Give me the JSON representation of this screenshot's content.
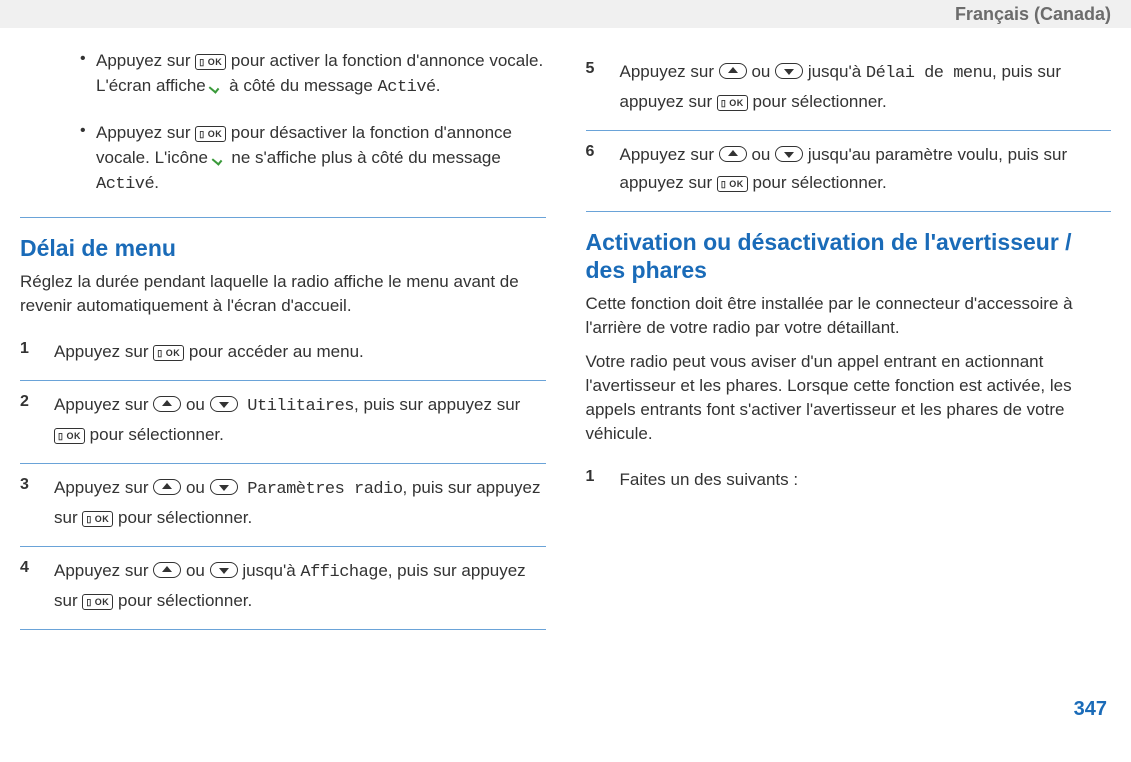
{
  "header": {
    "language": "Français (Canada)"
  },
  "pageNumber": "347",
  "bullets": [
    {
      "a": "Appuyez sur ",
      "b": " pour activer la fonction d'annonce vocale. L'écran affiche ",
      "c": " à côté du message ",
      "mono1": "Activé",
      "end": "."
    },
    {
      "a": "Appuyez sur ",
      "b": " pour désactiver la fonction d'annonce vocale. L'icône ",
      "c": " ne s'affiche plus à côté du message ",
      "mono1": "Activé",
      "end": "."
    }
  ],
  "section1": {
    "title": "Délai de menu",
    "intro": "Réglez la durée pendant laquelle la radio affiche le menu avant de revenir automatiquement à l'écran d'accueil."
  },
  "steps1": [
    {
      "num": "1",
      "a": "Appuyez sur ",
      "b": " pour accéder au menu."
    },
    {
      "num": "2",
      "a": "Appuyez sur ",
      "mid": " ou ",
      "mono": " Utilitaires",
      "b": ", puis sur appuyez sur ",
      "c": " pour sélectionner."
    },
    {
      "num": "3",
      "a": "Appuyez sur ",
      "mid": " ou ",
      "mono": " Paramètres radio",
      "b": ", puis sur appuyez sur ",
      "c": " pour sélectionner."
    },
    {
      "num": "4",
      "a": "Appuyez sur ",
      "mid": " ou ",
      "j": " jusqu'à ",
      "mono": "Affichage",
      "b": ", puis sur appuyez sur ",
      "c": " pour sélectionner."
    },
    {
      "num": "5",
      "a": "Appuyez sur ",
      "mid": " ou ",
      "j": " jusqu'à ",
      "mono": "Délai de menu",
      "b": ", puis sur appuyez sur ",
      "c": " pour sélectionner."
    },
    {
      "num": "6",
      "a": "Appuyez sur ",
      "mid": " ou ",
      "j": " jusqu'au paramètre voulu, puis sur appuyez sur ",
      "c": " pour sélectionner."
    }
  ],
  "section2": {
    "title": "Activation ou désactivation de l'avertisseur / des phares",
    "p1": "Cette fonction doit être installée par le connecteur d'accessoire à l'arrière de votre radio par votre détaillant.",
    "p2": "Votre radio peut vous aviser d'un appel entrant en actionnant l'avertisseur et les phares. Lorsque cette fonction est activée, les appels entrants font s'activer l'avertisseur et les phares de votre véhicule."
  },
  "steps2": [
    {
      "num": "1",
      "text": "Faites un des suivants :"
    }
  ],
  "okLabel": "▯ OK"
}
